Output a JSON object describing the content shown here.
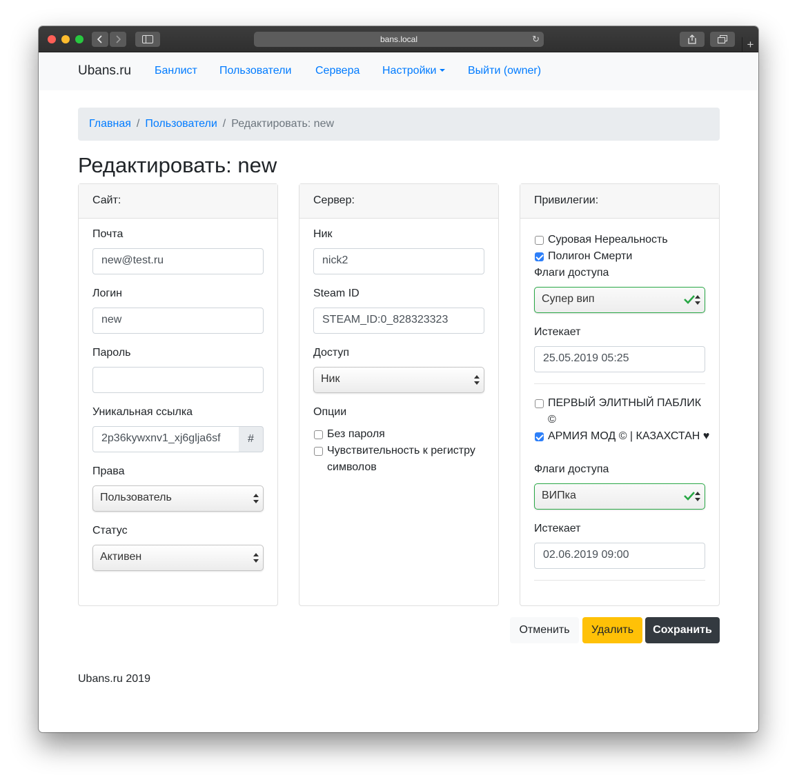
{
  "browser": {
    "url": "bans.local",
    "colors": {
      "close": "#ff5f57",
      "minimize": "#febc2e",
      "zoom": "#28c840"
    }
  },
  "navbar": {
    "brand": "Ubans.ru",
    "items": [
      {
        "label": "Банлист"
      },
      {
        "label": "Пользователи"
      },
      {
        "label": "Сервера"
      },
      {
        "label": "Настройки",
        "dropdown": true
      },
      {
        "label": "Выйти (owner)"
      }
    ]
  },
  "breadcrumb": {
    "items": [
      "Главная",
      "Пользователи"
    ],
    "separator": "/",
    "current": "Редактировать: new"
  },
  "page_title": "Редактировать: new",
  "site_card": {
    "header": "Сайт:",
    "email": {
      "label": "Почта",
      "value": "new@test.ru"
    },
    "login": {
      "label": "Логин",
      "value": "new"
    },
    "password": {
      "label": "Пароль",
      "value": ""
    },
    "link": {
      "label": "Уникальная ссылка",
      "value": "2p36kywxnv1_xj6glja6sf",
      "addon": "#"
    },
    "rights": {
      "label": "Права",
      "selected": "Пользователь"
    },
    "status": {
      "label": "Статус",
      "selected": "Активен"
    }
  },
  "server_card": {
    "header": "Сервер:",
    "nick": {
      "label": "Ник",
      "value": "nick2"
    },
    "steam_id": {
      "label": "Steam ID",
      "value": "STEAM_ID:0_828323323"
    },
    "access": {
      "label": "Доступ",
      "selected": "Ник"
    },
    "options": {
      "label": "Опции",
      "items": [
        {
          "label": "Без пароля",
          "checked": false
        },
        {
          "label": "Чувствительность к регистру символов",
          "checked": false
        }
      ]
    }
  },
  "privileges_card": {
    "header": "Привилегии:",
    "groups": [
      {
        "servers": [
          {
            "label": "Суровая Нереальность",
            "checked": false
          },
          {
            "label": "Полигон Смерти",
            "checked": true
          }
        ],
        "flags_label": "Флаги доступа",
        "flags_selected": "Супер вип",
        "expires_label": "Истекает",
        "expires_value": "25.05.2019 05:25"
      },
      {
        "servers": [
          {
            "label": "ПЕРВЫЙ ЭЛИТНЫЙ ПАБЛИК ©",
            "checked": false
          },
          {
            "label": "АРМИЯ МОД © | КАЗАХСТАН ♥",
            "checked": true
          }
        ],
        "flags_label": "Флаги доступа",
        "flags_selected": "ВИПка",
        "expires_label": "Истекает",
        "expires_value": "02.06.2019 09:00"
      }
    ]
  },
  "actions": {
    "cancel": "Отменить",
    "delete": "Удалить",
    "save": "Сохранить"
  },
  "footer": "Ubans.ru 2019",
  "colors": {
    "link": "#007bff",
    "success": "#28a745",
    "warning": "#ffc107",
    "dark": "#343a40"
  }
}
